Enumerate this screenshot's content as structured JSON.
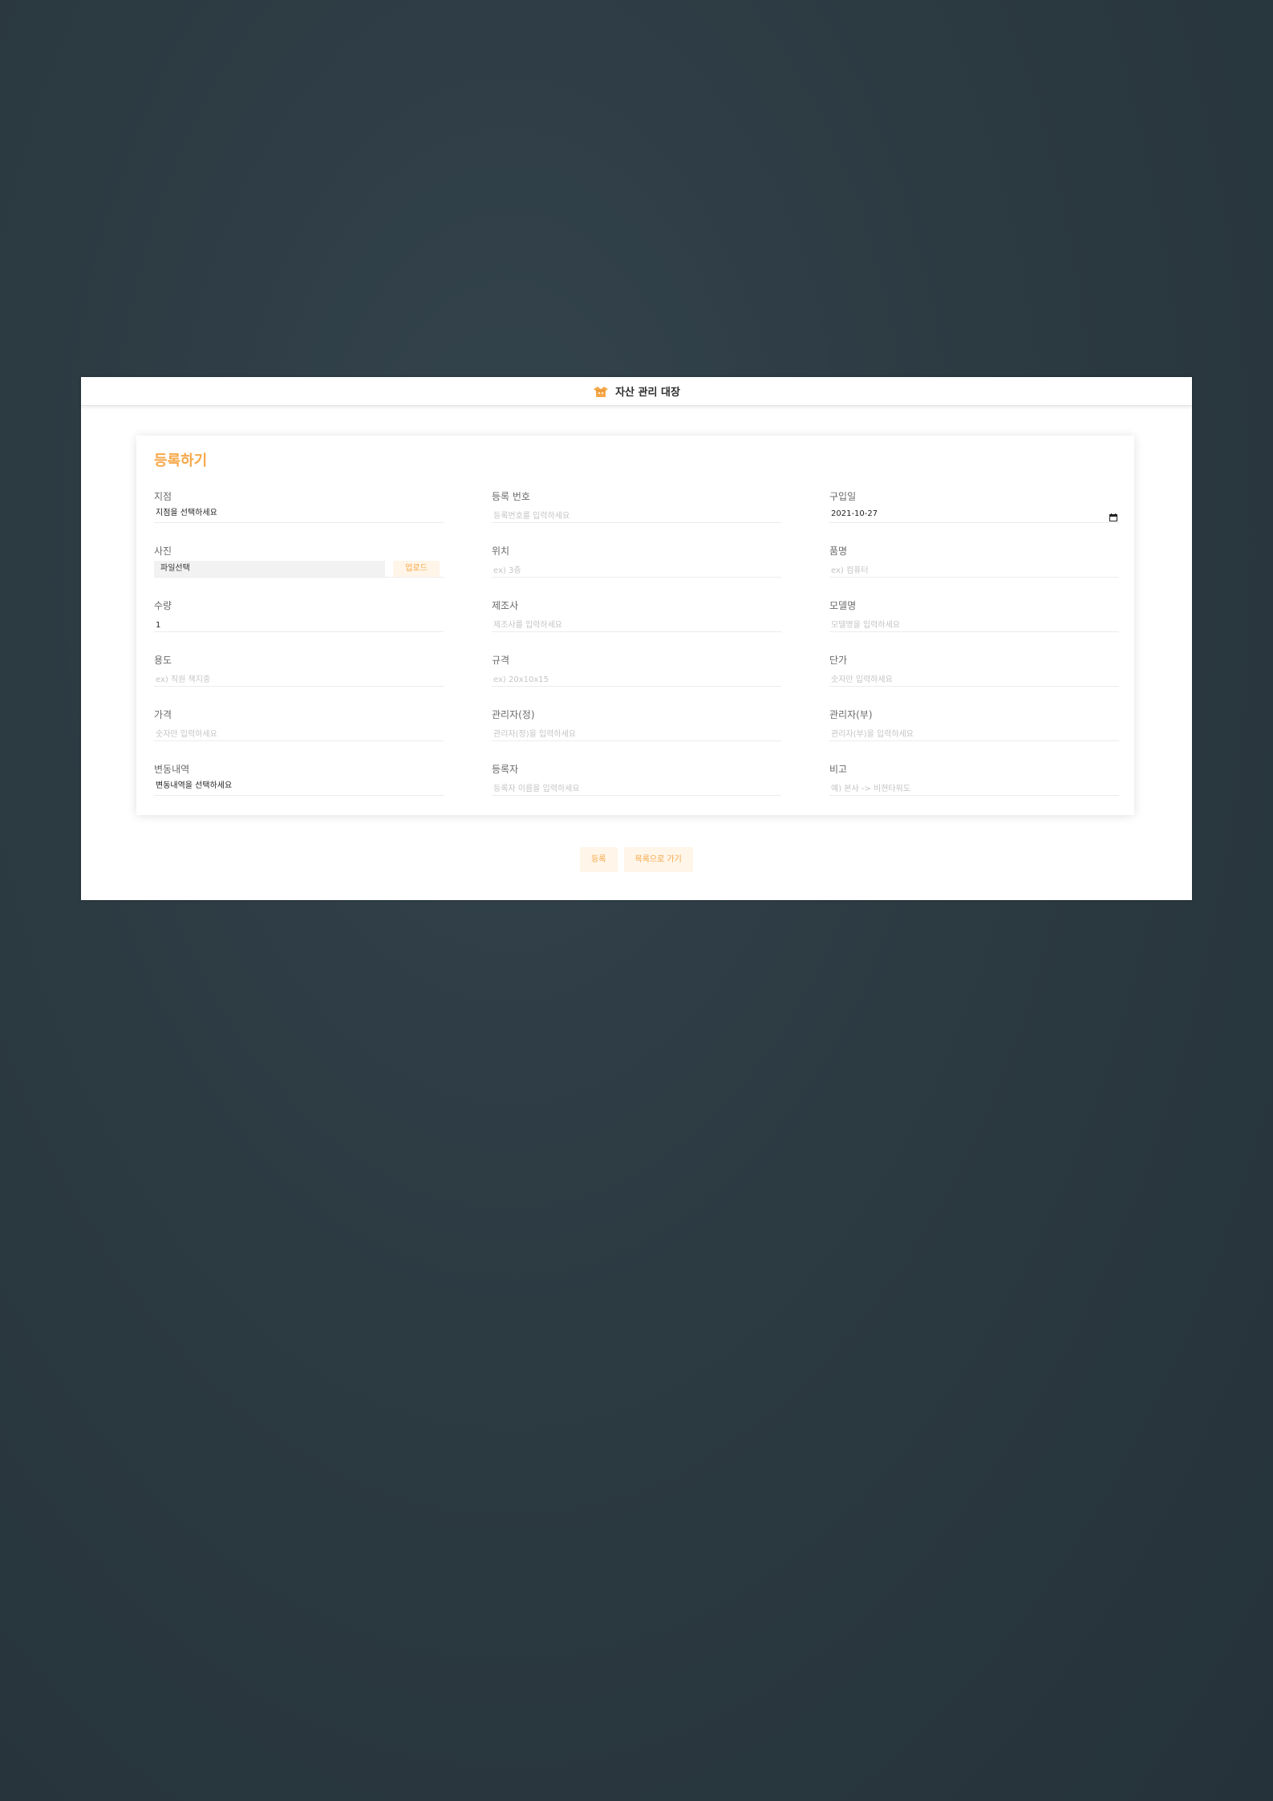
{
  "header": {
    "title": "자산 관리 대장",
    "icon": "box-icon"
  },
  "form": {
    "title": "등록하기",
    "fields": {
      "branch": {
        "label": "지점",
        "value": "지점을 선택하세요"
      },
      "reg_no": {
        "label": "등록 번호",
        "placeholder": "등록번호를 입력하세요"
      },
      "purchase_date": {
        "label": "구입일",
        "value": "2021-10-27"
      },
      "photo": {
        "label": "사진",
        "file_label": "파일선택",
        "upload_label": "업로드"
      },
      "location": {
        "label": "위치",
        "placeholder": "ex) 3층"
      },
      "item_name": {
        "label": "품명",
        "placeholder": "ex) 컴퓨터"
      },
      "quantity": {
        "label": "수량",
        "value": "1"
      },
      "maker": {
        "label": "제조사",
        "placeholder": "제조사를 입력하세요"
      },
      "model": {
        "label": "모델명",
        "placeholder": "모델명을 입력하세요"
      },
      "usage": {
        "label": "용도",
        "placeholder": "ex) 직원 책지중"
      },
      "spec": {
        "label": "규격",
        "placeholder": "ex) 20x10x15"
      },
      "unit_price": {
        "label": "단가",
        "placeholder": "숫자만 입력하세요"
      },
      "price": {
        "label": "가격",
        "placeholder": "숫자만 입력하세요"
      },
      "manager_main": {
        "label": "관리자(정)",
        "placeholder": "관리자(정)을 입력하세요"
      },
      "manager_sub": {
        "label": "관리자(부)",
        "placeholder": "관리자(부)을 입력하세요"
      },
      "change_history": {
        "label": "변동내역",
        "value": "변동내역을 선택하세요"
      },
      "registrant": {
        "label": "등록자",
        "placeholder": "등록자 이름을 입력하세요"
      },
      "note": {
        "label": "비고",
        "placeholder": "예) 본사 -> 비젼타워도"
      }
    }
  },
  "actions": {
    "submit_label": "등록",
    "back_label": "목록으로 가기"
  },
  "colors": {
    "accent": "#f6a84a",
    "accent_light": "#fff5e8",
    "background": "#2c3a42"
  }
}
